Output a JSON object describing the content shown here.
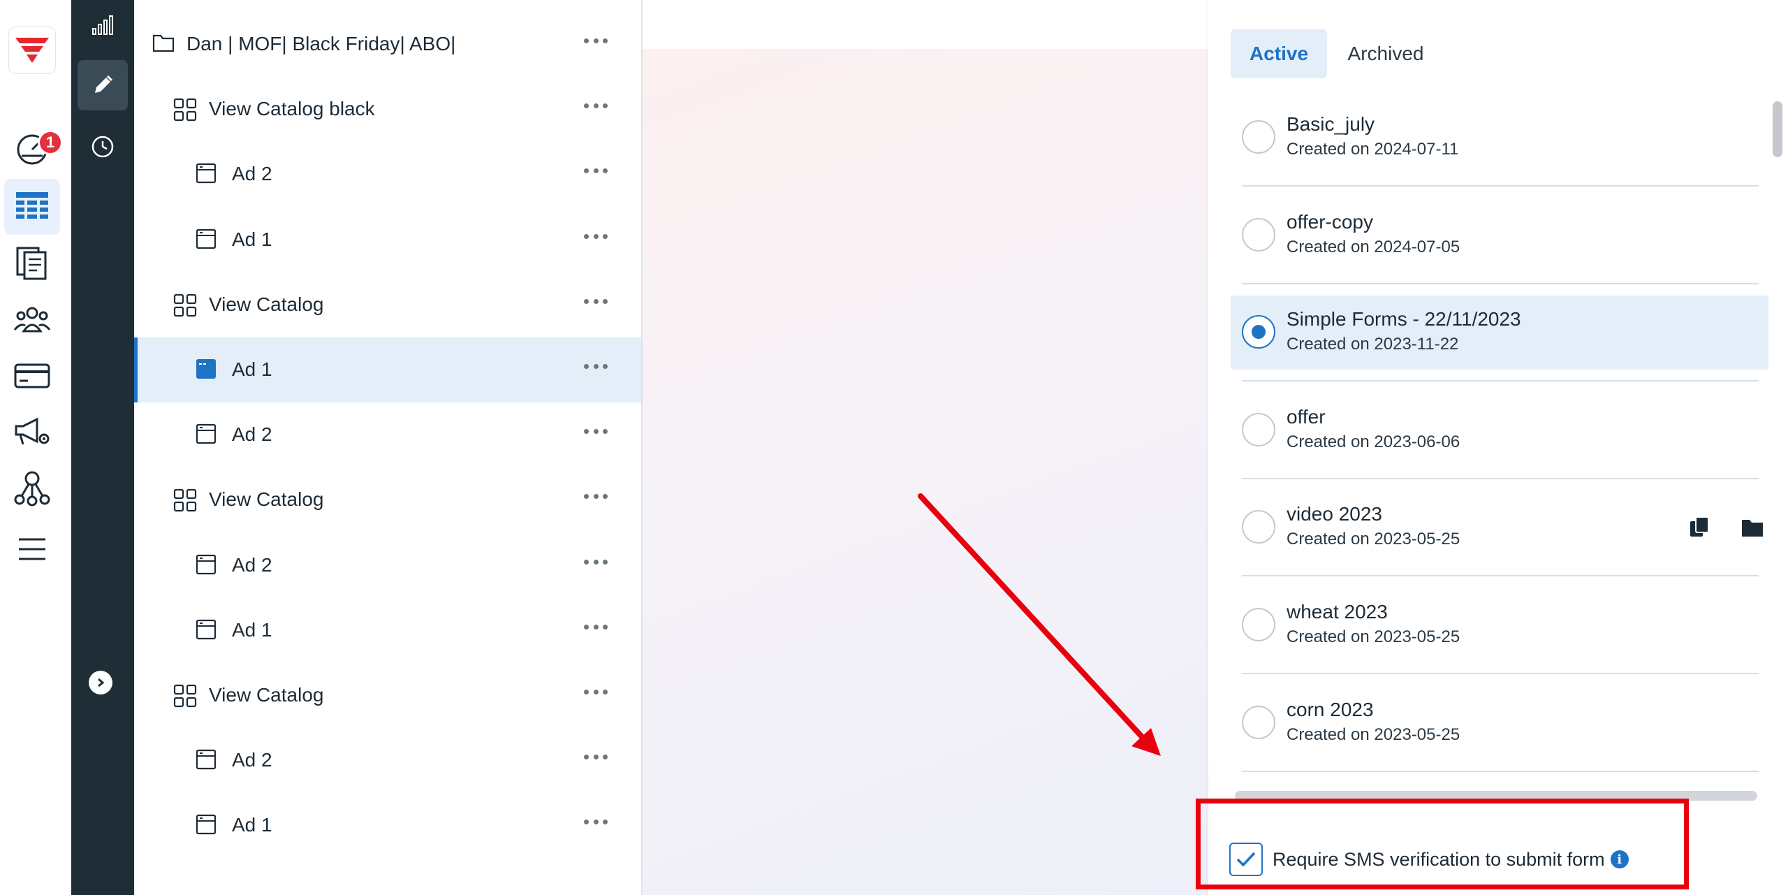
{
  "rail": {
    "items": [
      {
        "icon": "dashboard-gauge-icon",
        "badge": "1"
      },
      {
        "icon": "table-grid-icon",
        "active": true
      },
      {
        "icon": "documents-icon"
      },
      {
        "icon": "users-group-icon"
      },
      {
        "icon": "credit-card-icon"
      },
      {
        "icon": "megaphone-settings-icon"
      },
      {
        "icon": "network-nodes-icon"
      },
      {
        "icon": "menu-lines-icon"
      }
    ]
  },
  "darkbar": {
    "items": [
      {
        "icon": "bar-chart-icon"
      },
      {
        "icon": "pencil-icon",
        "active": true
      },
      {
        "icon": "clock-icon"
      }
    ],
    "expand_icon": "chevron-right-icon"
  },
  "tree": {
    "rows": [
      {
        "type": "folder",
        "label": "Dan | MOF| Black Friday| ABO|"
      },
      {
        "type": "adset",
        "label": "View Catalog black"
      },
      {
        "type": "ad",
        "label": "Ad 2"
      },
      {
        "type": "ad",
        "label": "Ad 1"
      },
      {
        "type": "adset",
        "label": "View Catalog"
      },
      {
        "type": "ad",
        "label": "Ad 1",
        "selected": true
      },
      {
        "type": "ad",
        "label": "Ad 2"
      },
      {
        "type": "adset",
        "label": "View Catalog"
      },
      {
        "type": "ad",
        "label": "Ad 2"
      },
      {
        "type": "ad",
        "label": "Ad 1"
      },
      {
        "type": "adset",
        "label": "View Catalog"
      },
      {
        "type": "ad",
        "label": "Ad 2"
      },
      {
        "type": "ad",
        "label": "Ad 1"
      }
    ]
  },
  "panel": {
    "tabs": {
      "active": "Active",
      "archived": "Archived"
    },
    "forms": [
      {
        "name": "Basic_july",
        "date": "Created on 2024-07-11"
      },
      {
        "name": "offer-copy",
        "date": "Created on 2024-07-05"
      },
      {
        "name": "Simple Forms - 22/11/2023",
        "date": "Created on 2023-11-22",
        "selected": true
      },
      {
        "name": "offer",
        "date": "Created on 2023-06-06"
      },
      {
        "name": "video 2023",
        "date": "Created on 2023-05-25",
        "actions": [
          "copy-icon",
          "folder-icon"
        ]
      },
      {
        "name": "wheat 2023",
        "date": "Created on 2023-05-25"
      },
      {
        "name": "corn 2023",
        "date": "Created on 2023-05-25"
      }
    ],
    "sms": {
      "label": "Require SMS verification to submit form",
      "checked": true,
      "info": "i"
    }
  },
  "colors": {
    "accent": "#1f73c4",
    "dark_nav": "#1f2d36",
    "annotation": "#e8000e",
    "badge": "#e0313f"
  }
}
